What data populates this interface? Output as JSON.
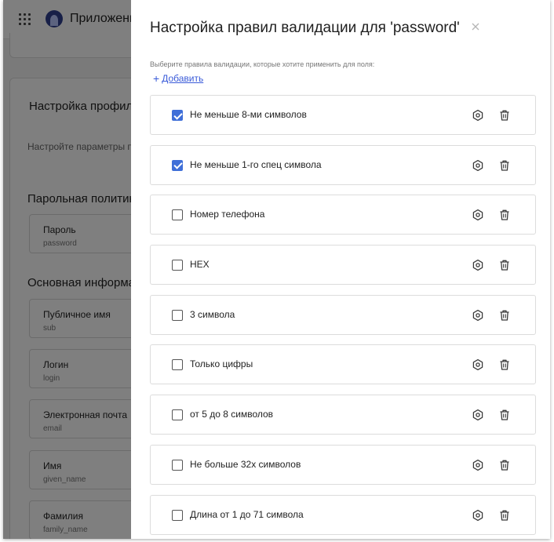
{
  "app": {
    "title": "Приложени",
    "card_title": "Настройка профиля",
    "card_subtitle": "Настройте параметры по",
    "section_password": "Парольная политика",
    "section_basic": "Основная информац",
    "fields": [
      {
        "label": "Пароль",
        "key": "password"
      },
      {
        "label": "Публичное имя",
        "key": "sub"
      },
      {
        "label": "Логин",
        "key": "login"
      },
      {
        "label": "Электронная почта",
        "key": "email"
      },
      {
        "label": "Имя",
        "key": "given_name"
      },
      {
        "label": "Фамилия",
        "key": "family_name"
      }
    ]
  },
  "drawer": {
    "title": "Настройка правил валидации для 'password'",
    "hint": "Выберите правила валидации, которые хотите применить для поля:",
    "add_label": "Добавить",
    "add_symbol": "+",
    "rules": [
      {
        "label": "Не меньше 8-ми символов",
        "checked": true
      },
      {
        "label": "Не меньше 1-го спец символа",
        "checked": true
      },
      {
        "label": "Номер телефона",
        "checked": false
      },
      {
        "label": "HEX",
        "checked": false
      },
      {
        "label": "3 символа",
        "checked": false
      },
      {
        "label": "Только цифры",
        "checked": false
      },
      {
        "label": "от 5 до 8 символов",
        "checked": false
      },
      {
        "label": "Не больше 32х символов",
        "checked": false
      },
      {
        "label": "Длина от 1 до 71 символа",
        "checked": false
      }
    ]
  },
  "icons": {
    "grid": "grid-icon",
    "close": "close-icon",
    "settings": "settings-icon",
    "delete": "trash-icon"
  },
  "colors": {
    "accent": "#3f6fd8",
    "link": "#3a5bd9"
  }
}
